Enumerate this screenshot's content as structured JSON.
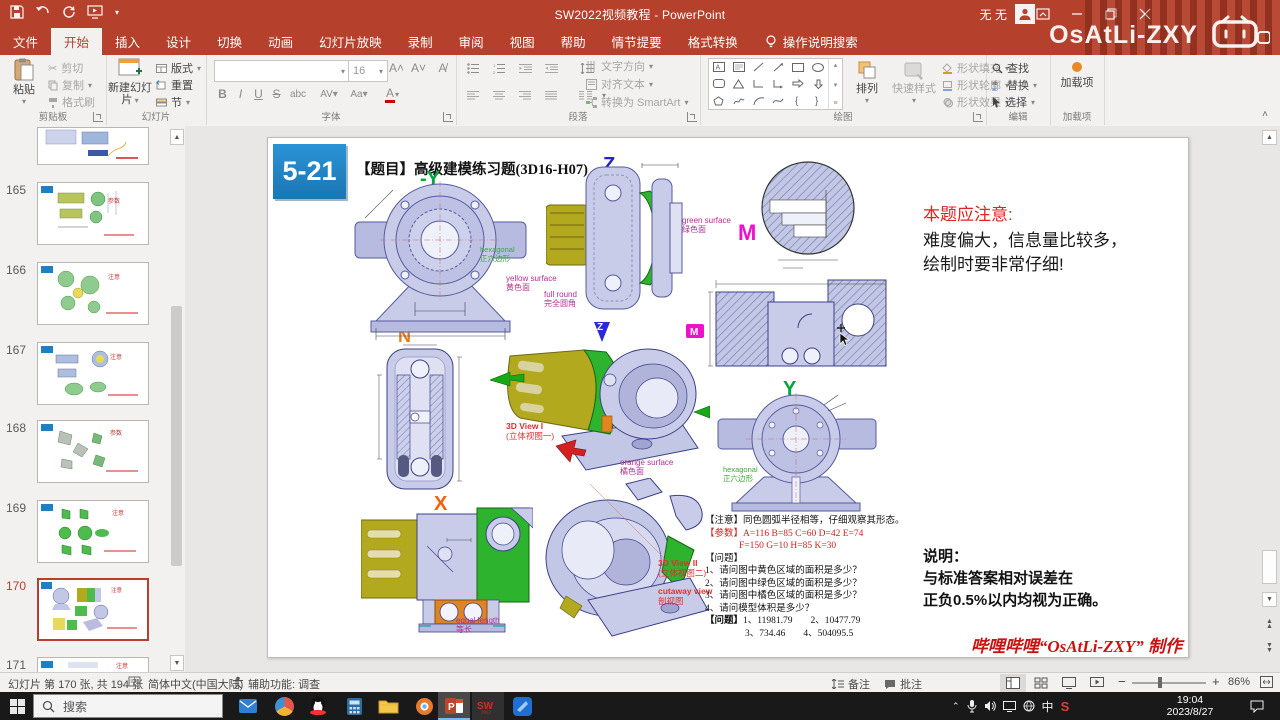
{
  "titlebar": {
    "title": "SW2022视频教程 - PowerPoint",
    "user_name": "无 无",
    "watermark_text": "OsAtLi-ZXY"
  },
  "tabs": [
    "文件",
    "开始",
    "插入",
    "设计",
    "切换",
    "动画",
    "幻灯片放映",
    "录制",
    "审阅",
    "视图",
    "帮助",
    "情节提要",
    "格式转换"
  ],
  "tell_me": "操作说明搜索",
  "ribbon": {
    "clipboard": {
      "label": "剪贴板",
      "paste": "粘贴",
      "cut": "剪切",
      "copy": "复制",
      "format_painter": "格式刷"
    },
    "slides": {
      "label": "幻灯片",
      "new_slide": "新建幻灯片",
      "layout": "版式",
      "reset": "重置",
      "section": "节"
    },
    "font": {
      "label": "字体",
      "size": "16",
      "bold": "B",
      "italic": "I",
      "underline": "U",
      "strike": "S"
    },
    "paragraph": {
      "label": "段落",
      "text_direction": "文字方向",
      "align_text": "对齐文本",
      "smartart": "转换为 SmartArt"
    },
    "drawing": {
      "label": "绘图",
      "arrange": "排列",
      "quick_styles": "快速样式",
      "shape_fill": "形状填充",
      "shape_outline": "形状轮廓",
      "shape_effects": "形状效果"
    },
    "editing": {
      "label": "编辑",
      "find": "查找",
      "replace": "替换",
      "select": "选择"
    },
    "addins": {
      "label": "加载项",
      "button": "加载项"
    }
  },
  "sidebar": {
    "slides": [
      {
        "num": ""
      },
      {
        "num": "165"
      },
      {
        "num": "166"
      },
      {
        "num": "167"
      },
      {
        "num": "168"
      },
      {
        "num": "169"
      },
      {
        "num": "170"
      },
      {
        "num": "171"
      }
    ],
    "selected": "170"
  },
  "slide": {
    "badge": "5-21",
    "title": "【题目】高级建模练习题(3D16-H07)",
    "views": {
      "front": "-Y",
      "top": "Z",
      "detail": "M",
      "left": "N",
      "back": "Y",
      "right": "X",
      "iso1": "3D View I",
      "iso1_zh": "(立体视图一)",
      "iso2": "3D View II",
      "iso2_zh": "(立体视图二)",
      "cutaway": "cutaway view",
      "cutaway_zh": "剖视图"
    },
    "labels": {
      "yellow_en": "yellow surface",
      "yellow_zh": "黄色面",
      "fullround_en": "full round",
      "fullround_zh": "完全圆角",
      "green_en": "green surface",
      "green_zh": "绿色面",
      "orange_en": "orange surface",
      "orange_zh": "橘色面",
      "hex_en": "hexagonal",
      "hex_zh": "正六边形",
      "equal_en": "equal length",
      "equal_zh": "等长"
    },
    "note": {
      "title": "本题应注意:",
      "line1": "难度偏大，信息量比较多，",
      "line2": "绘制时要非常仔细!"
    },
    "remark": {
      "attention": "【注意】同色圆弧半径相等，仔细观察其形态。",
      "params_label": "【参数】",
      "params1": "A=116  B=85  C=60  D=42  E=74",
      "params2": "F=150  G=10  H=85  K=30",
      "q_label": "【问题】",
      "q1": "1、请问图中黄色区域的面积是多少？",
      "q2": "2、请问图中绿色区域的面积是多少？",
      "q3": "3、请问图中橘色区域的面积是多少？",
      "q4": "4、请问模型体积是多少？",
      "a_label": "【问题】",
      "a1": "1、11981.79",
      "a2": "2、10477.79",
      "a3": "3、734.46",
      "a4": "4、504095.5"
    },
    "explain": {
      "title": "说明：",
      "line1": "与标准答案相对误差在",
      "line2": "正负0.5%以内均视为正确。"
    },
    "credit": "哔哩哔哩“OsAtLi-ZXY” 制作"
  },
  "statusbar": {
    "slide_info": "幻灯片 第 170 张, 共 194 张",
    "language": "简体中文(中国大陆)",
    "accessibility": "辅助功能: 调查",
    "notes": "备注",
    "comments": "批注",
    "zoom": "86%"
  },
  "taskbar": {
    "search": "搜索",
    "ime": "中",
    "time": "19:04",
    "date": "2023/8/27"
  },
  "colors": {
    "accent": "#b5402b",
    "badge_blue": "#1b80c4",
    "part_lavender": "#c9cce9",
    "part_yellow": "#b3a91f",
    "part_green": "#2db32d",
    "part_orange": "#dd8426",
    "label_green": "#00a63e",
    "label_blue": "#2323cc",
    "label_magenta": "#ee11cc",
    "label_orange": "#e87c17",
    "label_red": "#e03030"
  }
}
